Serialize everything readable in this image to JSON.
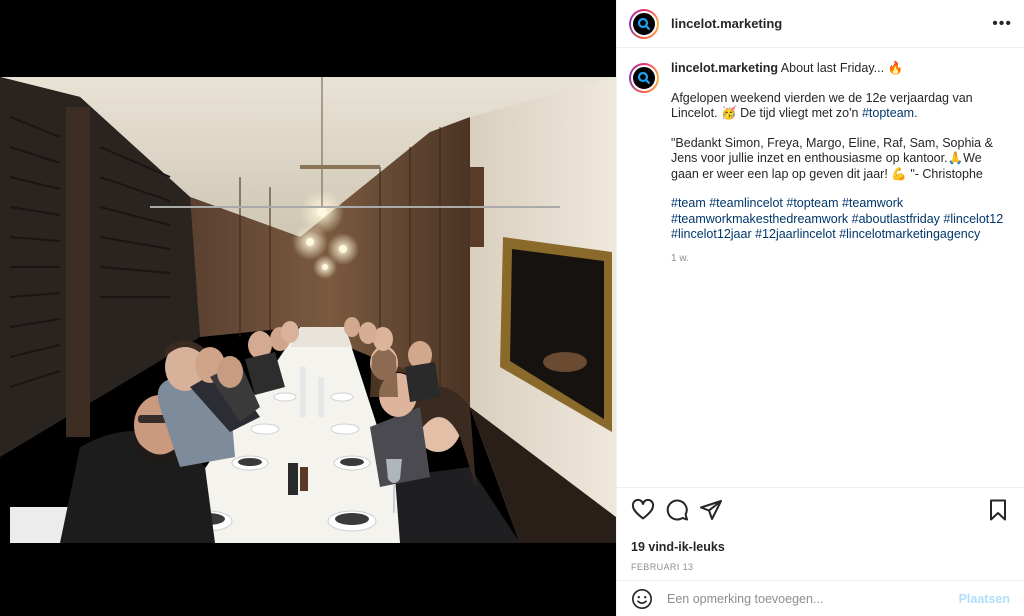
{
  "post": {
    "username": "lincelot.marketing",
    "more_glyph": "•••",
    "caption": {
      "line1": "About last Friday... 🔥",
      "para1": "Afgelopen weekend vierden we de 12e verjaardag van Lincelot. 🥳 De tijd vliegt met zo'n ",
      "para1_tag": "#topteam",
      "para1_end": ".",
      "para2": "\"Bedankt Simon, Freya, Margo, Eline, Raf, Sam, Sophia & Jens voor jullie inzet en enthousiasme op kantoor.🙏We gaan er weer een lap op geven dit jaar! 💪 \"- Christophe",
      "hashtags": [
        "#team",
        "#teamlincelot",
        "#topteam",
        "#teamwork",
        "#teamworkmakesthedreamwork",
        "#aboutlastfriday",
        "#lincelot12",
        "#lincelot12jaar",
        "#12jaarlincelot",
        "#lincelotmarketingagency"
      ],
      "time_ago": "1 w."
    },
    "likes": "19 vind-ik-leuks",
    "date": "FEBRUARI 13",
    "comment": {
      "placeholder": "Een opmerking toevoegen...",
      "post_label": "Plaatsen"
    },
    "icons": {
      "like": "heart-icon",
      "comment": "comment-icon",
      "share": "share-icon",
      "save": "bookmark-icon",
      "emoji": "emoji-icon",
      "more": "more-icon"
    },
    "colors": {
      "hashtag": "#00376b",
      "muted": "#8e8e8e",
      "post_button": "#b2dffc"
    }
  }
}
